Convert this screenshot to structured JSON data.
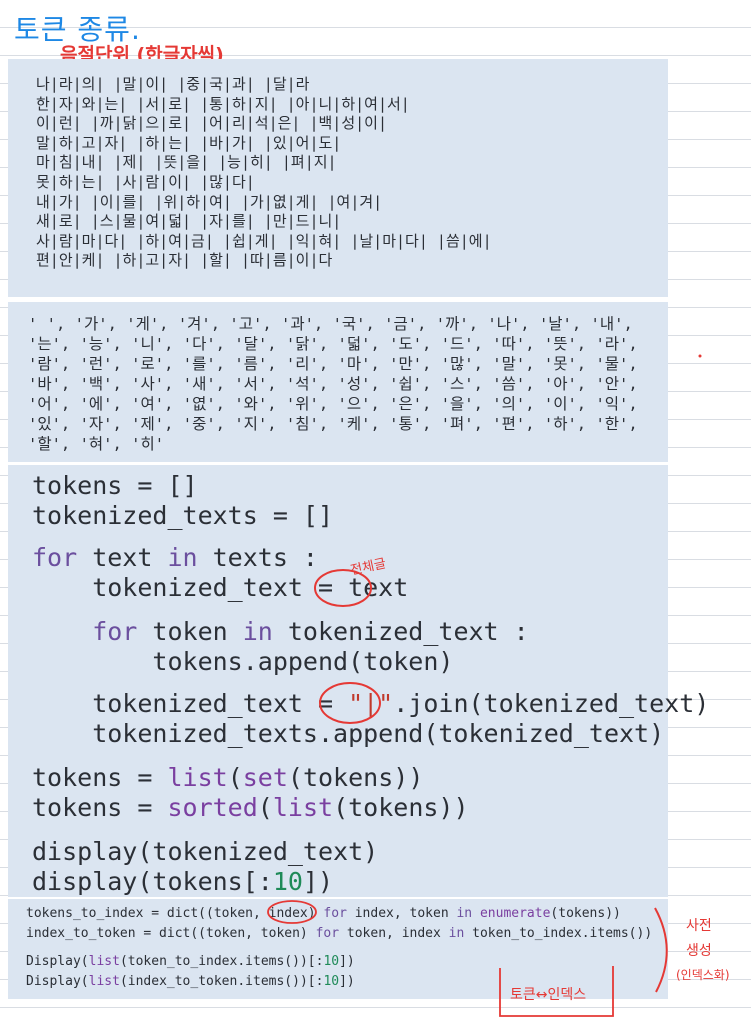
{
  "title_note": "토큰 종류.",
  "subtitle_note": "음절단위 (한글자씩)",
  "syllable_lines": [
    "나|라|의| |말|이| |중|국|과| |달|라",
    "한|자|와|는| |서|로| |통|하|지| |아|니|하|여|서|",
    "이|런| |까|닭|으|로| |어|리|석|은| |백|성|이|",
    "말|하|고|자| |하|는| |바|가| |있|어|도|",
    "마|침|내| |제| |뜻|을| |능|히| |펴|지|",
    "못|하|는| |사|람|이| |많|다|",
    "내|가| |이|를| |위|하|여| |가|엾|게| |여|겨|",
    "새|로| |스|물|여|덟| |자|를| |만|드|니|",
    "사|람|마|다| |하|여|금| |쉽|게| |익|혀| |날|마|다| |씀|에|",
    "편|안|케| |하|고|자| |할| |따|름|이|다"
  ],
  "token_lines": [
    "' ', '가', '게', '겨', '고', '과', '국', '금', '까', '나', '날', '내',",
    "'는', '능', '니', '다', '달', '닭', '덟', '도', '드', '따', '뜻', '라',",
    "'람', '런', '로', '를', '름', '리', '마', '만', '많', '말', '못', '물',",
    "'바', '백', '사', '새', '서', '석', '성', '쉽', '스', '씀', '아', '안',",
    "'어', '에', '여', '엾', '와', '위', '으', '은', '을', '의', '이', '익',",
    "'있', '자', '제', '중', '지', '침', '케', '통', '펴', '편', '하', '한',",
    "'할', '혀', '히'"
  ],
  "code": {
    "l1_a": "tokens = []",
    "l2_a": "tokenized_texts = []",
    "l3_for": "for",
    "l3_var": " text ",
    "l3_in": "in",
    "l3_rest": " texts :",
    "l4_a": "    tokenized_text = ",
    "l4_b": "text",
    "l5_for": "    for",
    "l5_var": " token ",
    "l5_in": "in",
    "l5_rest": " tokenized_text :",
    "l6_a": "        tokens.append(token)",
    "l7_a": "    tokenized_text = ",
    "l7_str": "\"|\"",
    "l7_b": ".join(tokenized_text)",
    "l8_a": "    tokenized_texts.append(tokenized_text)",
    "l9_a": "tokens = ",
    "l9_fn1": "list",
    "l9_b": "(",
    "l9_fn2": "set",
    "l9_c": "(tokens))",
    "l10_a": "tokens = ",
    "l10_fn1": "sorted",
    "l10_b": "(",
    "l10_fn2": "list",
    "l10_c": "(tokens))",
    "l11_a": "display(tokenized_text)",
    "l12_a": "display(tokens[:",
    "l12_num": "10",
    "l12_b": "])"
  },
  "small_code": {
    "s1_a": "tokens_to_index = dict((token, index) ",
    "s1_for": "for",
    "s1_b": " index, token ",
    "s1_in": "in",
    "s1_fn": " enumerate",
    "s1_c": "(tokens))",
    "s2_a": "index_to_token = dict((token, token) ",
    "s2_for": "for",
    "s2_b": " token, index ",
    "s2_in": "in",
    "s2_c": " token_to_index.items())",
    "s3_a": "Display(",
    "s3_fn": "list",
    "s3_b": "(token_to_index.items())[:",
    "s3_num": "10",
    "s3_c": "])",
    "s4_a": "Display(",
    "s4_fn": "list",
    "s4_b": "(index_to_token.items())[:",
    "s4_num": "10",
    "s4_c": "])"
  },
  "annotations": {
    "whole_sentence": "전체글",
    "dict_1": "사전",
    "dict_2": "생성",
    "dict_3": "(인덱스화)",
    "token_index": "토큰↔인덱스"
  },
  "colors": {
    "panel": "#dbe5f1",
    "blue_ink": "#1e88e5",
    "red_ink": "#e53935"
  }
}
